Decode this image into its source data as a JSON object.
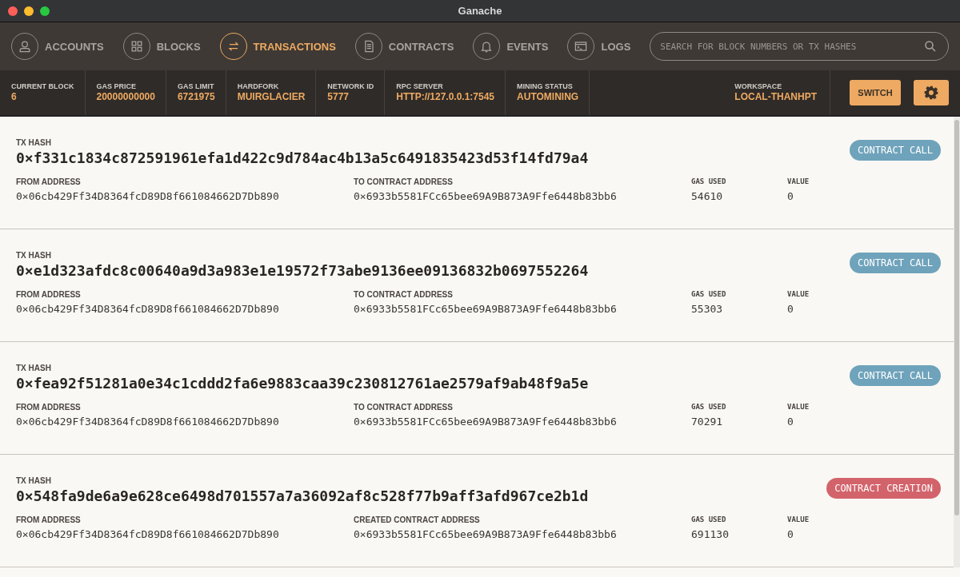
{
  "window": {
    "title": "Ganache"
  },
  "nav": [
    {
      "label": "ACCOUNTS",
      "selected": false
    },
    {
      "label": "BLOCKS",
      "selected": false
    },
    {
      "label": "TRANSACTIONS",
      "selected": true
    },
    {
      "label": "CONTRACTS",
      "selected": false
    },
    {
      "label": "EVENTS",
      "selected": false
    },
    {
      "label": "LOGS",
      "selected": false
    }
  ],
  "search": {
    "placeholder": "SEARCH FOR BLOCK NUMBERS OR TX HASHES"
  },
  "status_bar": {
    "items": [
      {
        "label": "CURRENT BLOCK",
        "value": "6"
      },
      {
        "label": "GAS PRICE",
        "value": "20000000000"
      },
      {
        "label": "GAS LIMIT",
        "value": "6721975"
      },
      {
        "label": "HARDFORK",
        "value": "MUIRGLACIER"
      },
      {
        "label": "NETWORK ID",
        "value": "5777"
      },
      {
        "label": "RPC SERVER",
        "value": "HTTP://127.0.0.1:7545"
      },
      {
        "label": "MINING STATUS",
        "value": "AUTOMINING"
      }
    ],
    "workspace": {
      "label": "WORKSPACE",
      "value": "LOCAL-THANHPT"
    },
    "switch_button": "SWITCH"
  },
  "transactions": [
    {
      "kind": "call",
      "hash_label": "TX HASH",
      "hash": "0×f331c1834c872591961efa1d422c9d784ac4b13a5c6491835423d53f14fd79a4",
      "from_label": "FROM ADDRESS",
      "from": "0×06cb429Ff34D8364fcD89D8f661084662D7Db890",
      "to_label": "TO CONTRACT ADDRESS",
      "to": "0×6933b5581FCc65bee69A9B873A9Ffe6448b83bb6",
      "gas_label": "GAS USED",
      "gas": "54610",
      "value_label": "VALUE",
      "value": "0",
      "badge": "CONTRACT CALL"
    },
    {
      "kind": "call",
      "hash_label": "TX HASH",
      "hash": "0×e1d323afdc8c00640a9d3a983e1e19572f73abe9136ee09136832b0697552264",
      "from_label": "FROM ADDRESS",
      "from": "0×06cb429Ff34D8364fcD89D8f661084662D7Db890",
      "to_label": "TO CONTRACT ADDRESS",
      "to": "0×6933b5581FCc65bee69A9B873A9Ffe6448b83bb6",
      "gas_label": "GAS USED",
      "gas": "55303",
      "value_label": "VALUE",
      "value": "0",
      "badge": "CONTRACT CALL"
    },
    {
      "kind": "call",
      "hash_label": "TX HASH",
      "hash": "0×fea92f51281a0e34c1cddd2fa6e9883caa39c230812761ae2579af9ab48f9a5e",
      "from_label": "FROM ADDRESS",
      "from": "0×06cb429Ff34D8364fcD89D8f661084662D7Db890",
      "to_label": "TO CONTRACT ADDRESS",
      "to": "0×6933b5581FCc65bee69A9B873A9Ffe6448b83bb6",
      "gas_label": "GAS USED",
      "gas": "70291",
      "value_label": "VALUE",
      "value": "0",
      "badge": "CONTRACT CALL"
    },
    {
      "kind": "creation",
      "hash_label": "TX HASH",
      "hash": "0×548fa9de6a9e628ce6498d701557a7a36092af8c528f77b9aff3afd967ce2b1d",
      "from_label": "FROM ADDRESS",
      "from": "0×06cb429Ff34D8364fcD89D8f661084662D7Db890",
      "to_label": "CREATED CONTRACT ADDRESS",
      "to": "0×6933b5581FCc65bee69A9B873A9Ffe6448b83bb6",
      "gas_label": "GAS USED",
      "gas": "691130",
      "value_label": "VALUE",
      "value": "0",
      "badge": "CONTRACT CREATION"
    }
  ]
}
